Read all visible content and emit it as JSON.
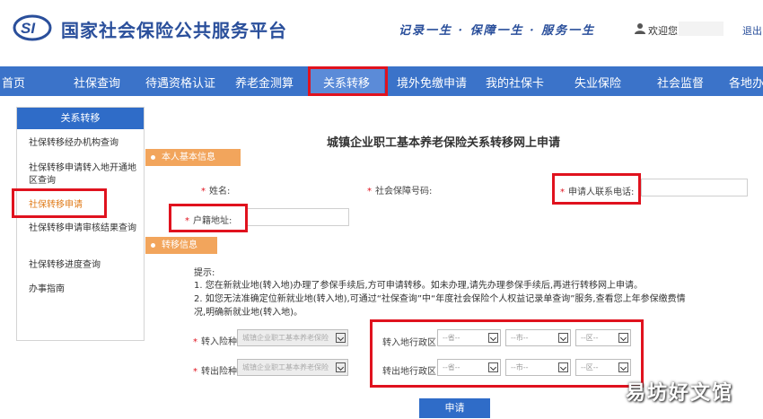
{
  "header": {
    "logo_text": "SI",
    "site_title": "国家社会保险公共服务平台",
    "slogan": "记录一生 · 保障一生 · 服务一生",
    "welcome": "欢迎您,",
    "logout": "退出"
  },
  "nav": {
    "items": [
      "首页",
      "社保查询",
      "待遇资格认证",
      "养老金测算",
      "关系转移",
      "境外免缴申请",
      "我的社保卡",
      "失业保险",
      "社会监督",
      "各地办"
    ],
    "active": "关系转移"
  },
  "sidebar": {
    "title": "关系转移",
    "items": [
      "社保转移经办机构查询",
      "社保转移申请转入地开通地区查询",
      "社保转移申请",
      "社保转移申请审核结果查询",
      "社保转移进度查询",
      "办事指南"
    ],
    "active": "社保转移申请"
  },
  "form": {
    "title": "城镇企业职工基本养老保险关系转移网上申请",
    "section_basic": "本人基本信息",
    "name_label": "姓名:",
    "ssn_label": "社会保障号码:",
    "phone_label": "申请人联系电话:",
    "address_label": "户籍地址:",
    "section_transfer": "转移信息",
    "tips_title": "提示:",
    "tip1": "1. 您在新就业地(转入地)办理了参保手续后,方可申请转移。如未办理,请先办理参保手续后,再进行转移网上申请。",
    "tip2a": "2. 如您无法准确定位新就业地(转入地),可通过“社保查询”中“年度社会保险个人权益记录单查询”服务,查看您上年参保缴费情",
    "tip2b": "况,明确新就业地(转入地)。",
    "in_insurance_label": "转入险种",
    "out_insurance_label": "转出险种",
    "insurance_value": "城镇企业职工基本养老保险",
    "in_region_label": "转入地行政区",
    "out_region_label": "转出地行政区",
    "province_placeholder": "--省--",
    "city_placeholder": "--市--",
    "district_placeholder": "--区--",
    "submit": "申请"
  },
  "watermark": "易坊好文馆",
  "colors": {
    "primary": "#3b73c9",
    "highlight": "#e0121e",
    "accent": "#f2a55c"
  }
}
